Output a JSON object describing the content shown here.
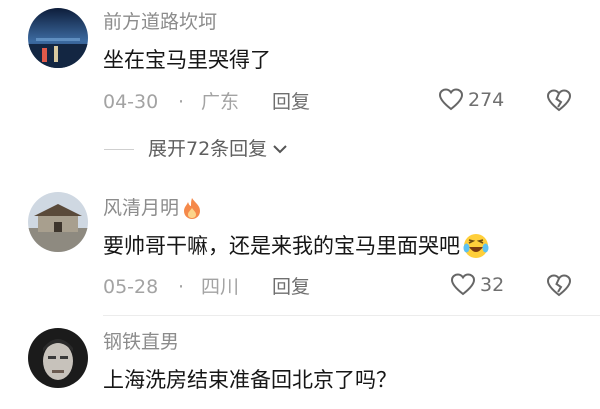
{
  "comments": [
    {
      "username": "前方道路坎坷",
      "text": "坐在宝马里哭得了",
      "date": "04-30",
      "separator": "·",
      "location": "广东",
      "reply_label": "回复",
      "likes": "274",
      "replies_toggle": "展开72条回复"
    },
    {
      "username": "风清月明",
      "text": "要帅哥干嘛，还是来我的宝马里面哭吧",
      "date": "05-28",
      "separator": "·",
      "location": "四川",
      "reply_label": "回复",
      "likes": "32"
    },
    {
      "username": "钢铁直男",
      "text": "上海洗房结束准备回北京了吗？"
    }
  ],
  "icons": {
    "like": "heart-outline-icon",
    "dislike": "broken-heart-icon",
    "expand": "chevron-down-icon",
    "badge": "flame-icon",
    "emoji": "laughing-tears-emoji"
  }
}
